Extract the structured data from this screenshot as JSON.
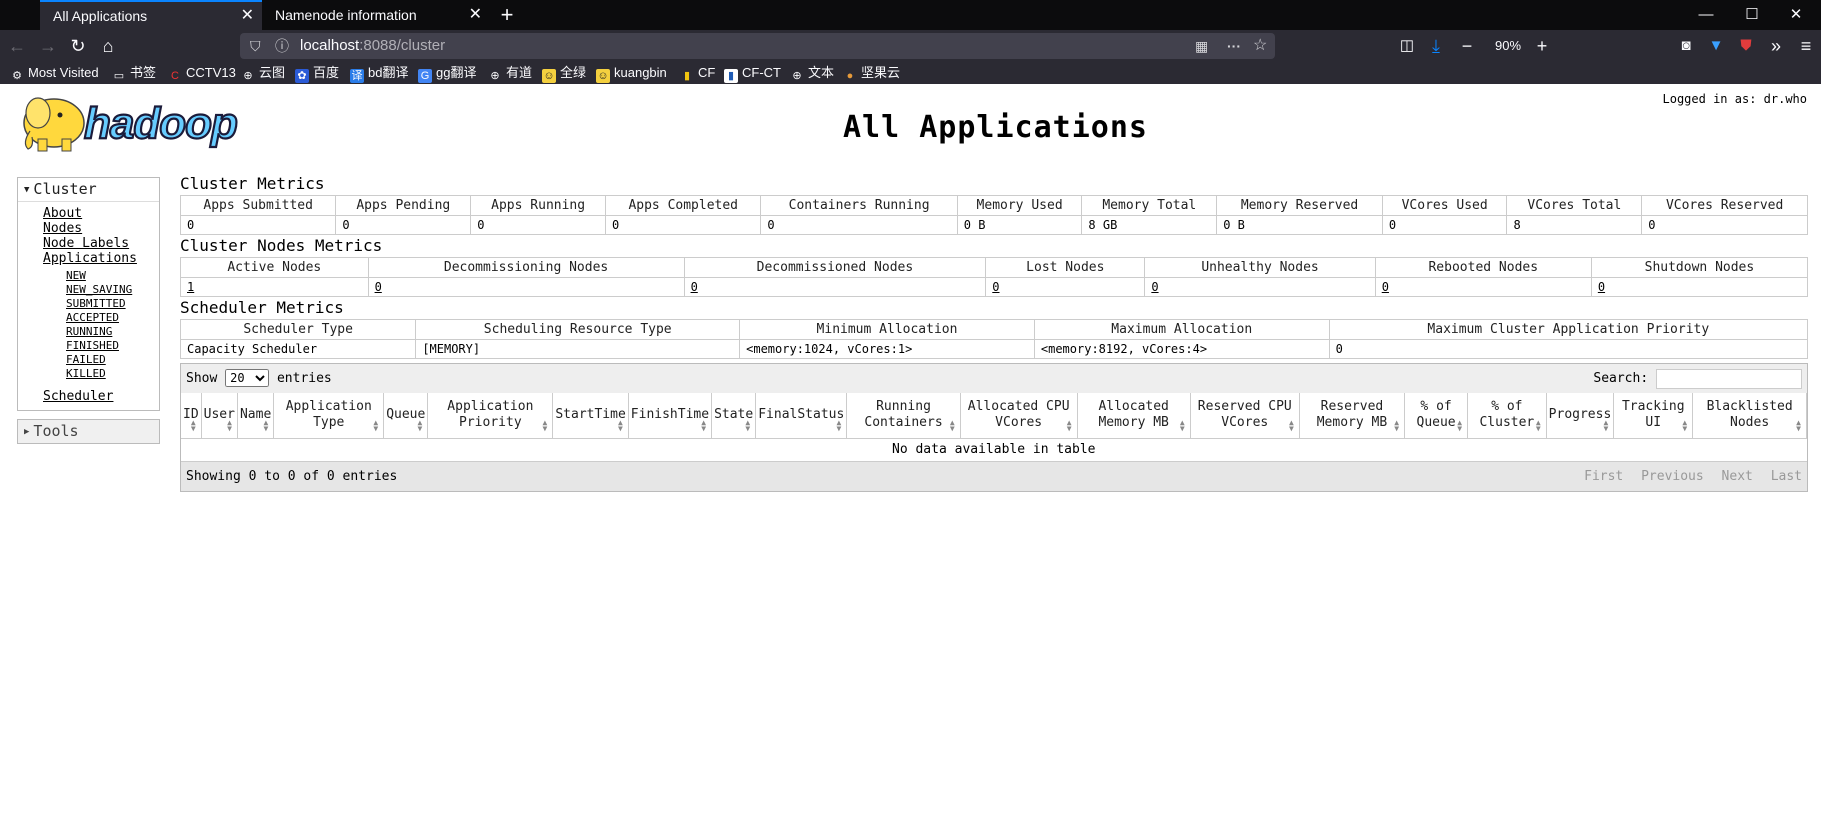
{
  "browser": {
    "tabs": [
      {
        "label": "All Applications",
        "active": true
      },
      {
        "label": "Namenode information",
        "active": false
      }
    ],
    "url_host": "localhost",
    "url_path": ":8088/cluster",
    "zoom": "90%",
    "bookmarks": [
      {
        "label": "Most Visited",
        "icon": "gear-icon"
      },
      {
        "label": "书签",
        "icon": "folder-icon"
      },
      {
        "label": "CCTV13",
        "icon": "cctv-icon"
      },
      {
        "label": "云图",
        "icon": "globe-icon"
      },
      {
        "label": "百度",
        "icon": "baidu-icon"
      },
      {
        "label": "bd翻译",
        "icon": "translate-icon"
      },
      {
        "label": "gg翻译",
        "icon": "google-translate-icon"
      },
      {
        "label": "有道",
        "icon": "globe-icon"
      },
      {
        "label": "全绿",
        "icon": "face-icon"
      },
      {
        "label": "kuangbin",
        "icon": "face-icon"
      },
      {
        "label": "CF",
        "icon": "bar-icon"
      },
      {
        "label": "CF-CT",
        "icon": "bar-icon"
      },
      {
        "label": "文本",
        "icon": "globe-icon"
      },
      {
        "label": "坚果云",
        "icon": "nut-icon"
      }
    ]
  },
  "header": {
    "title": "All Applications",
    "login": "Logged in as: dr.who"
  },
  "sidebar": {
    "cluster_label": "Cluster",
    "links": [
      "About",
      "Nodes",
      "Node Labels",
      "Applications"
    ],
    "app_states": [
      "NEW",
      "NEW_SAVING",
      "SUBMITTED",
      "ACCEPTED",
      "RUNNING",
      "FINISHED",
      "FAILED",
      "KILLED"
    ],
    "scheduler": "Scheduler",
    "tools_label": "Tools"
  },
  "cluster_metrics": {
    "title": "Cluster Metrics",
    "headers": [
      "Apps Submitted",
      "Apps Pending",
      "Apps Running",
      "Apps Completed",
      "Containers Running",
      "Memory Used",
      "Memory Total",
      "Memory Reserved",
      "VCores Used",
      "VCores Total",
      "VCores Reserved"
    ],
    "values": [
      "0",
      "0",
      "0",
      "0",
      "0",
      "0 B",
      "8 GB",
      "0 B",
      "0",
      "8",
      "0"
    ]
  },
  "node_metrics": {
    "title": "Cluster Nodes Metrics",
    "headers": [
      "Active Nodes",
      "Decommissioning Nodes",
      "Decommissioned Nodes",
      "Lost Nodes",
      "Unhealthy Nodes",
      "Rebooted Nodes",
      "Shutdown Nodes"
    ],
    "values": [
      "1",
      "0",
      "0",
      "0",
      "0",
      "0",
      "0"
    ]
  },
  "scheduler_metrics": {
    "title": "Scheduler Metrics",
    "headers": [
      "Scheduler Type",
      "Scheduling Resource Type",
      "Minimum Allocation",
      "Maximum Allocation",
      "Maximum Cluster Application Priority"
    ],
    "values": [
      "Capacity Scheduler",
      "[MEMORY]",
      "<memory:1024, vCores:1>",
      "<memory:8192, vCores:4>",
      "0"
    ]
  },
  "apps_table": {
    "show_label": "Show",
    "page_size": "20",
    "entries_label": "entries",
    "search_label": "Search:",
    "columns": [
      "ID",
      "User",
      "Name",
      "Application Type",
      "Queue",
      "Application Priority",
      "StartTime",
      "FinishTime",
      "State",
      "FinalStatus",
      "Running Containers",
      "Allocated CPU VCores",
      "Allocated Memory MB",
      "Reserved CPU VCores",
      "Reserved Memory MB",
      "% of Queue",
      "% of Cluster",
      "Progress",
      "Tracking UI",
      "Blacklisted Nodes"
    ],
    "empty_text": "No data available in table",
    "info": "Showing 0 to 0 of 0 entries",
    "pager": [
      "First",
      "Previous",
      "Next",
      "Last"
    ]
  }
}
